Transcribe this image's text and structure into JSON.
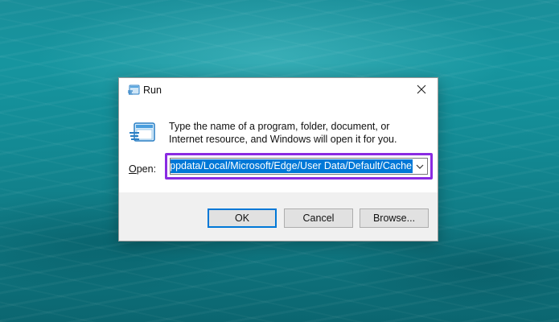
{
  "dialog": {
    "title": "Run",
    "description": "Type the name of a program, folder, document, or Internet resource, and Windows will open it for you.",
    "open_label_accel": "O",
    "open_label_rest": "pen:",
    "input_value": "ppdata/Local/Microsoft/Edge/User Data/Default/Cache",
    "buttons": {
      "ok": "OK",
      "cancel": "Cancel",
      "browse": "Browse..."
    }
  },
  "colors": {
    "selection": "#0078d7",
    "highlight_frame": "#8a2be2",
    "background_water": "#138a94"
  },
  "icons": [
    "run-app-icon",
    "close-icon",
    "chevron-down-icon"
  ]
}
